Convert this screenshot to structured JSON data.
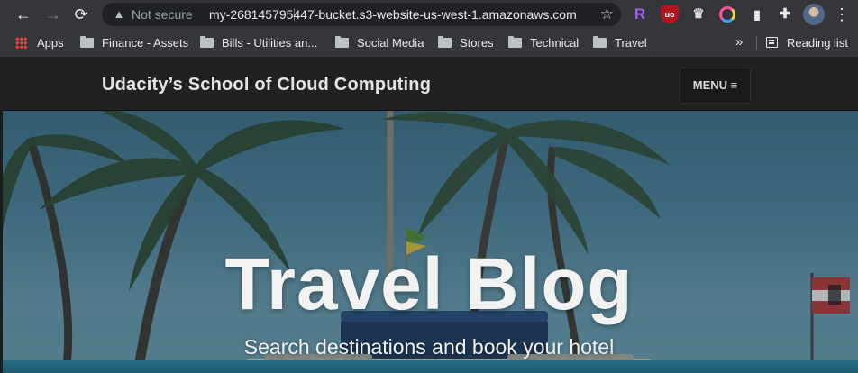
{
  "browser": {
    "security_status": "Not secure",
    "url": "my-268145795447-bucket.s3-website-us-west-1.amazonaws.com",
    "extensions": [
      "R",
      "uo"
    ],
    "icons": {
      "back": "←",
      "forward": "→",
      "reload": "⟳",
      "warning": "▲",
      "star": "☆",
      "hat": "♛",
      "clipboard": "▮",
      "puzzle": "✚",
      "kebab": "⋮",
      "chevron": "»"
    }
  },
  "bookmarks": {
    "items": [
      {
        "label": "Apps"
      },
      {
        "label": "Finance - Assets"
      },
      {
        "label": "Bills - Utilities an..."
      },
      {
        "label": "Social Media"
      },
      {
        "label": "Stores"
      },
      {
        "label": "Technical"
      },
      {
        "label": "Travel"
      }
    ],
    "reading_list": "Reading list"
  },
  "site": {
    "title": "Udacity’s School of Cloud Computing",
    "menu_label": "MENU ≡"
  },
  "hero": {
    "title": "Travel Blog",
    "subtitle": "Search destinations and book your hotel"
  }
}
